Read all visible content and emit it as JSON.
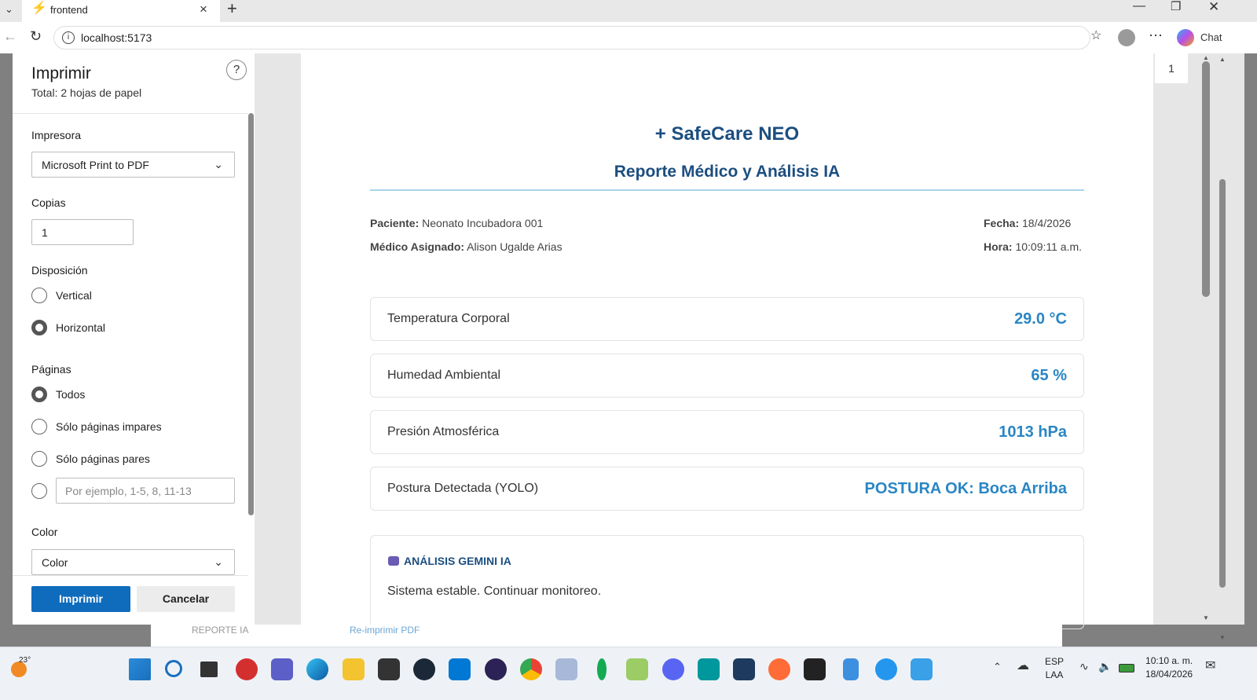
{
  "browser": {
    "tab_title": "frontend",
    "url": "localhost:5173",
    "chat_label": "Chat"
  },
  "print": {
    "title": "Imprimir",
    "total": "Total: 2 hojas de papel",
    "help": "?",
    "printer_label": "Impresora",
    "printer_value": "Microsoft Print to PDF",
    "copies_label": "Copias",
    "copies_value": "1",
    "layout_label": "Disposición",
    "layout_options": [
      "Vertical",
      "Horizontal"
    ],
    "layout_selected": "Horizontal",
    "pages_label": "Páginas",
    "pages_options": [
      "Todos",
      "Sólo páginas impares",
      "Sólo páginas pares"
    ],
    "pages_selected": "Todos",
    "pages_placeholder": "Por ejemplo, 1-5, 8, 11-13",
    "color_label": "Color",
    "color_value": "Color",
    "print_button": "Imprimir",
    "cancel_button": "Cancelar",
    "page_indicator": "1"
  },
  "report": {
    "brand": "+ SafeCare NEO",
    "subtitle": "Reporte Médico y Análisis IA",
    "patient_label": "Paciente:",
    "patient_value": "Neonato Incubadora 001",
    "doctor_label": "Médico Asignado:",
    "doctor_value": "Alison Ugalde Arias",
    "date_label": "Fecha:",
    "date_value": "18/4/2026",
    "time_label": "Hora:",
    "time_value": "10:09:11 a.m.",
    "metrics": [
      {
        "label": "Temperatura Corporal",
        "value": "29.0 °C"
      },
      {
        "label": "Humedad Ambiental",
        "value": "65 %"
      },
      {
        "label": "Presión Atmosférica",
        "value": "1013 hPa"
      },
      {
        "label": "Postura Detectada (YOLO)",
        "value": "POSTURA OK: Boca Arriba"
      }
    ],
    "ai_title": "ANÁLISIS GEMINI IA",
    "ai_text": "Sistema estable. Continuar monitoreo."
  },
  "underlay": {
    "left_text": "REPORTE IA",
    "right_text": "Re-imprimir PDF"
  },
  "taskbar": {
    "weather": "23°",
    "lang_top": "ESP",
    "lang_bottom": "LAA",
    "time": "10:10 a. m.",
    "date": "18/04/2026"
  },
  "colors": {
    "accent": "#0f6cbd",
    "brand": "#1c4e80",
    "metric_value": "#2a86c4"
  }
}
